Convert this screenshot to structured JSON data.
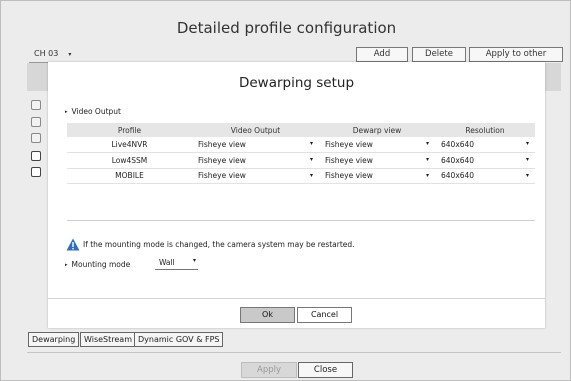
{
  "window": {
    "title": "Detailed profile configuration",
    "channel_label": "CH 03",
    "channel_arrow": "▾",
    "buttons": {
      "add": "Add",
      "delete": "Delete",
      "apply_other": "Apply to other channels"
    },
    "bottom_tabs": [
      "Dewarping",
      "WiseStream",
      "Dynamic GOV & FPS"
    ],
    "apply_label": "Apply",
    "close_label": "Close"
  },
  "dialog": {
    "title": "Dewarping setup",
    "video_output_label": "Video Output",
    "columns": [
      "Profile",
      "Video Output",
      "Dewarp view",
      "Resolution"
    ],
    "rows": [
      {
        "profile": "Live4NVR",
        "video_output": "Fisheye view",
        "dewarp_view": "Fisheye view",
        "resolution": "640x640"
      },
      {
        "profile": "Low4SSM",
        "video_output": "Fisheye view",
        "dewarp_view": "Fisheye view",
        "resolution": "640x640"
      },
      {
        "profile": "MOBILE",
        "video_output": "Fisheye view",
        "dewarp_view": "Fisheye view",
        "resolution": "640x640"
      }
    ],
    "dropdown_arrow": "▾",
    "warning_text": "If the mounting mode is changed, the camera system may be restarted.",
    "mounting_mode_label": "Mounting mode",
    "mounting_mode_value": "Wall",
    "ok_label": "Ok",
    "cancel_label": "Cancel"
  },
  "colors": {
    "warning_icon": "#2f6fc0",
    "ok_button": "#c9c9c9"
  },
  "icons": {
    "warning": "warning-triangle-icon",
    "dropdown": "chevron-down-icon",
    "bullet": "bullet-icon"
  }
}
